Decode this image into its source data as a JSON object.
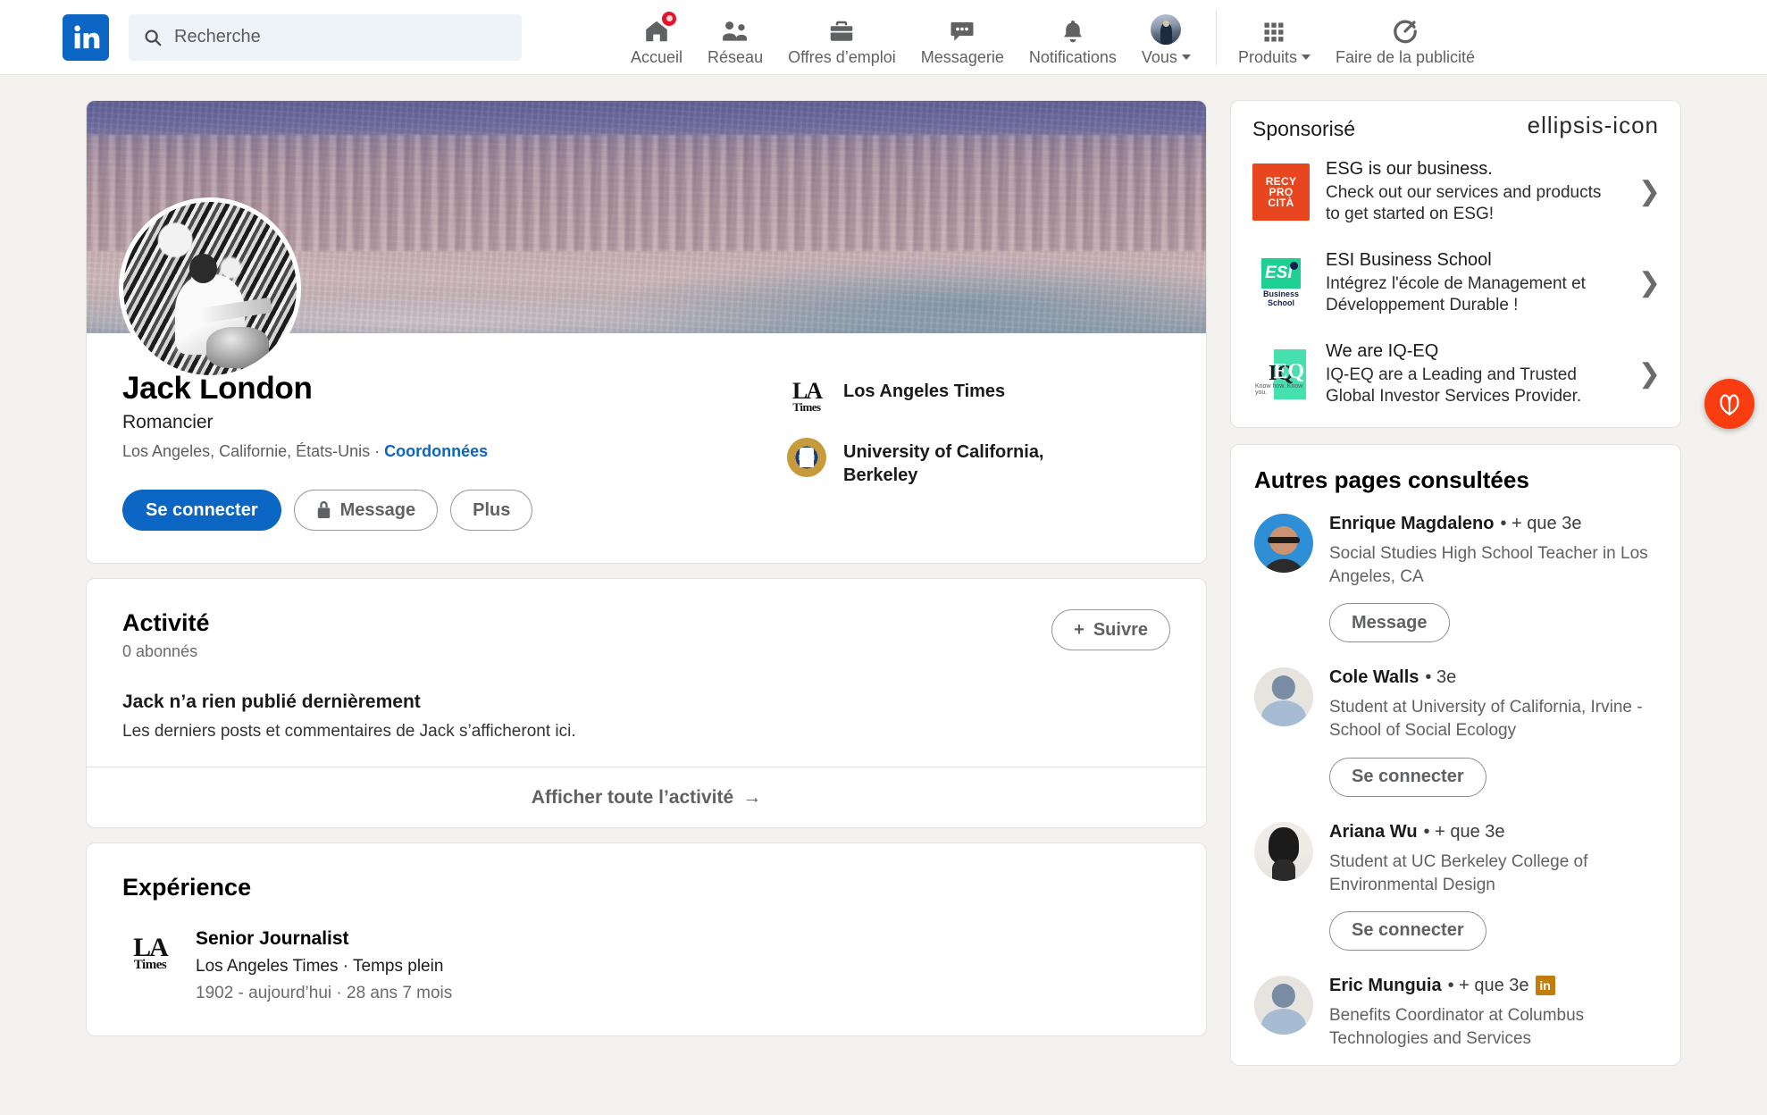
{
  "nav": {
    "logo_icon": "linkedin-logo-icon",
    "search": {
      "placeholder": "Recherche",
      "value": "",
      "icon": "search-icon"
    },
    "items": [
      {
        "label": "Accueil",
        "icon": "home-icon",
        "badge": true
      },
      {
        "label": "Réseau",
        "icon": "network-people-icon",
        "badge": false
      },
      {
        "label": "Offres d’emploi",
        "icon": "briefcase-icon",
        "badge": false
      },
      {
        "label": "Messagerie",
        "icon": "message-bubble-icon",
        "badge": false
      },
      {
        "label": "Notifications",
        "icon": "bell-icon",
        "badge": false
      },
      {
        "label": "Vous",
        "icon": "user-avatar-icon",
        "badge": false,
        "caret": true
      }
    ],
    "right_items": [
      {
        "label": "Produits",
        "icon": "grid-apps-icon",
        "caret": true
      },
      {
        "label": "Faire de la publicité",
        "icon": "advertise-target-icon",
        "caret": false
      }
    ]
  },
  "profile": {
    "cover_icon": "cover-photo",
    "avatar_icon": "profile-photo",
    "name": "Jack London",
    "headline": "Romancier",
    "location": "Los Angeles, Californie, États-Unis",
    "location_separator": " · ",
    "contact_link": "Coordonnées",
    "buttons": {
      "connect": "Se connecter",
      "message": "Message",
      "more": "Plus"
    },
    "affiliations": [
      {
        "name": "Los Angeles Times",
        "icon": "la-times-logo-icon"
      },
      {
        "name": "University of California, Berkeley",
        "icon": "uc-berkeley-seal-icon"
      }
    ]
  },
  "activity": {
    "title": "Activité",
    "followers": "0 abonnés",
    "follow_button": "Suivre",
    "empty_title": "Jack n’a rien publié dernièrement",
    "empty_desc": "Les derniers posts et commentaires de Jack s’afficheront ici.",
    "footer_link": "Afficher toute l’activité",
    "footer_arrow": "→"
  },
  "experience": {
    "title": "Expérience",
    "items": [
      {
        "role": "Senior Journalist",
        "company_line": "Los Angeles Times · Temps plein",
        "meta": "1902 - aujourd’hui · 28 ans 7 mois",
        "icon": "la-times-logo-icon"
      }
    ]
  },
  "sponsored": {
    "title": "Sponsorisé",
    "more_icon": "ellipsis-icon",
    "ads": [
      {
        "logo_icon": "recyprocita-logo-icon",
        "logo_text_lines": [
          "RECY",
          "PRO",
          "CITÀ"
        ],
        "title": "ESG is our business.",
        "desc": "Check out our services and products to get started on ESG!",
        "chevron": "❯"
      },
      {
        "logo_icon": "esi-business-school-logo-icon",
        "logo_sub_lines": [
          "Business",
          "School"
        ],
        "title": "ESI Business School",
        "desc": "Intégrez l'école de Management et Développement Durable !",
        "chevron": "❯"
      },
      {
        "logo_icon": "iq-eq-logo-icon",
        "logo_tagline": "Know how. Know you.",
        "title": "We are IQ-EQ",
        "desc": "IQ-EQ are a Leading and Trusted Global Investor Services Provider.",
        "chevron": "❯"
      }
    ]
  },
  "other_pages": {
    "title": "Autres pages consultées",
    "people": [
      {
        "name": "Enrique Magdaleno",
        "degree": "• + que 3e",
        "desc": "Social Studies High School Teacher in Los Angeles, CA",
        "action": "Message",
        "avatar_icon": "avatar-enrique-magdaleno",
        "in_badge": false
      },
      {
        "name": "Cole Walls",
        "degree": "• 3e",
        "desc": "Student at University of California, Irvine - School of Social Ecology",
        "action": "Se connecter",
        "avatar_icon": "avatar-generic-placeholder",
        "in_badge": false
      },
      {
        "name": "Ariana Wu",
        "degree": "• + que 3e",
        "desc": "Student at UC Berkeley College of Environmental Design",
        "action": "Se connecter",
        "avatar_icon": "avatar-ariana-wu",
        "in_badge": false
      },
      {
        "name": "Eric Munguia",
        "degree": "• + que 3e",
        "desc": "Benefits Coordinator at Columbus Technologies and Services",
        "action": "",
        "avatar_icon": "avatar-generic-placeholder",
        "in_badge": true,
        "in_badge_label": "in"
      }
    ]
  },
  "floating": {
    "icon": "butterfly-assistant-icon",
    "color": "#fa3c11"
  },
  "colors": {
    "brand_blue": "#0a66c2",
    "page_bg": "#f4f2ee",
    "card_bg": "#ffffff",
    "border": "#e4e2e0",
    "text_primary": "#1a1a1a",
    "text_secondary": "#5f6163",
    "notification_red": "#e7122b",
    "ad_orange": "#e8461e",
    "esi_green": "#1ecf93",
    "iqeq_green": "#46dfae",
    "in_badge_gold": "#c37d0e"
  }
}
